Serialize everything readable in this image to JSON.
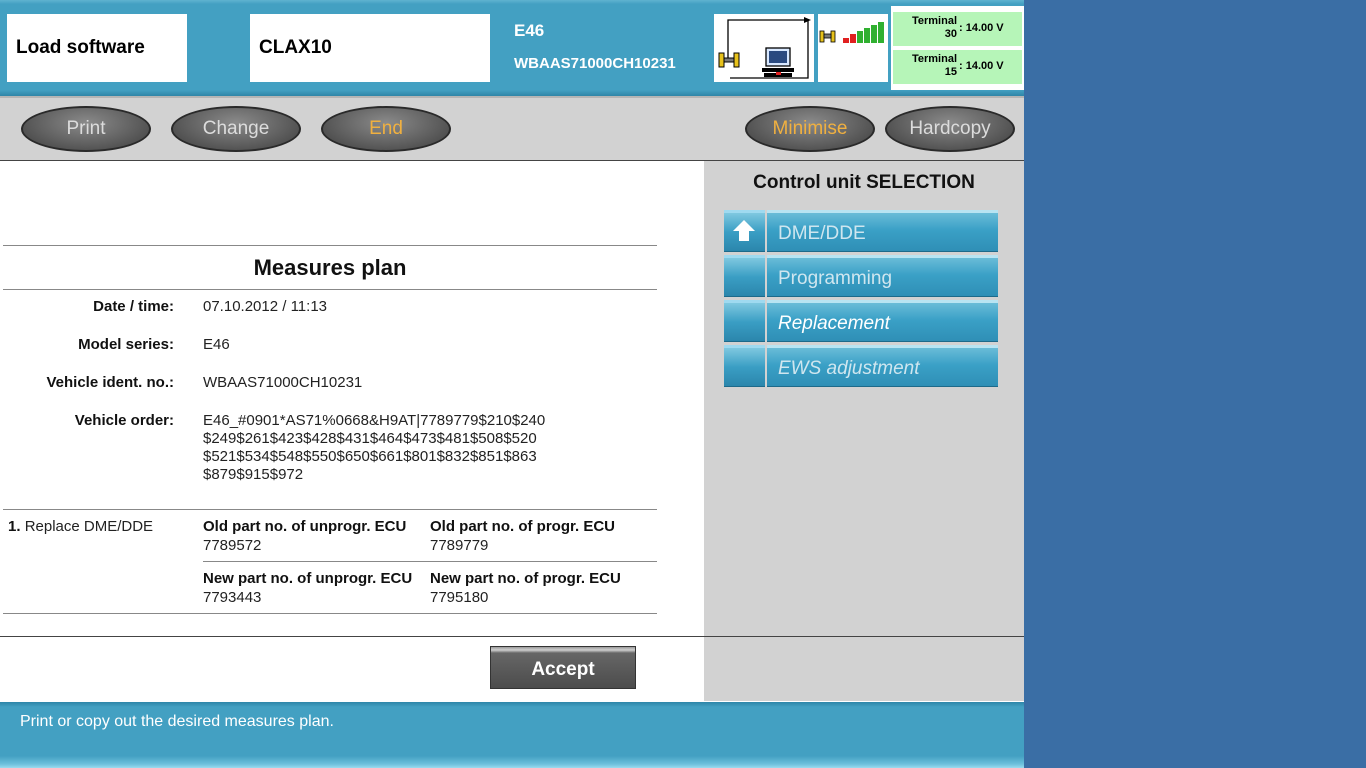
{
  "header": {
    "function": "Load software",
    "ecu": "CLAX10",
    "series": "E46",
    "vin": "WBAAS71000CH10231",
    "terminals": [
      {
        "label_line1": "Terminal",
        "label_line2": "30",
        "voltage": ": 14.00 V"
      },
      {
        "label_line1": "Terminal",
        "label_line2": "15",
        "voltage": ": 14.00 V"
      }
    ]
  },
  "toolbar": {
    "print": "Print",
    "change": "Change",
    "end": "End",
    "minimise": "Minimise",
    "hardcopy": "Hardcopy"
  },
  "measures": {
    "title": "Measures plan",
    "fields": [
      {
        "label": "Date / time:",
        "value": "07.10.2012 / 11:13"
      },
      {
        "label": "Model series:",
        "value": "E46"
      },
      {
        "label": "Vehicle ident. no.:",
        "value": "WBAAS71000CH10231"
      },
      {
        "label": "Vehicle order:",
        "lines": [
          "E46_#0901*AS71%0668&H9AT|7789779$210$240",
          "$249$261$423$428$431$464$473$481$508$520",
          "$521$534$548$550$650$661$801$832$851$863",
          "$879$915$972"
        ]
      }
    ],
    "replacement": {
      "number": "1.",
      "text": "Replace DME/DDE",
      "old_unprog_label": "Old part no. of unprogr. ECU",
      "old_unprog_value": "7789572",
      "old_prog_label": "Old part no. of progr. ECU",
      "old_prog_value": "7789779",
      "new_unprog_label": "New part no. of unprogr. ECU",
      "new_unprog_value": "7793443",
      "new_prog_label": "New part no. of progr. ECU",
      "new_prog_value": "7795180"
    },
    "accept": "Accept"
  },
  "panel": {
    "title": "Control unit SELECTION",
    "items": [
      {
        "label": "DME/DDE"
      },
      {
        "label": "Programming"
      },
      {
        "label": "Replacement"
      },
      {
        "label": "EWS adjustment"
      }
    ]
  },
  "status": "Print or copy out the desired measures plan.",
  "colors": {
    "accent": "#43a0c2",
    "button_text_highlight": "#f0b040",
    "terminal_ok": "#b6f5b8"
  }
}
